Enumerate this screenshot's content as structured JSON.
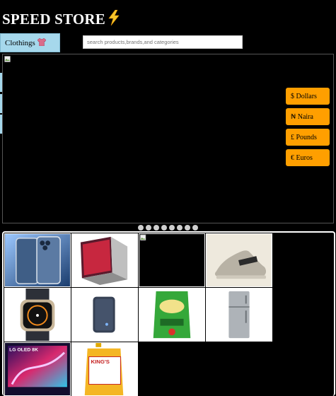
{
  "header": {
    "brand": "SPEED STORE",
    "brand_icon": "⚡"
  },
  "category_button": {
    "label": "Clothings",
    "icon": "👚"
  },
  "search": {
    "placeholder": "search products,brands,and categories"
  },
  "currency_buttons": [
    {
      "label": "$ Dollars"
    },
    {
      "label": "₦ Naira"
    },
    {
      "label": "£ Pounds"
    },
    {
      "label": "€ Euros"
    }
  ],
  "carousel": {
    "dots": 8
  },
  "products": [
    {
      "name": "iphone-product-image",
      "icon": "smartphone"
    },
    {
      "name": "laptop-product-image",
      "icon": "laptop"
    },
    {
      "name": "broken-product-image",
      "icon": "broken-image"
    },
    {
      "name": "sneaker-product-image",
      "icon": "sneaker"
    },
    {
      "name": "smartwatch-product-image",
      "icon": "smartwatch"
    },
    {
      "name": "powerbank-product-image",
      "icon": "power-bank"
    },
    {
      "name": "rice-bag-product-image",
      "icon": "rice-bag"
    },
    {
      "name": "refrigerator-product-image",
      "icon": "refrigerator"
    },
    {
      "name": "tv-product-image",
      "icon": "television"
    },
    {
      "name": "oil-jerrycan-product-image",
      "icon": "oil-jerrycan"
    }
  ],
  "product_images": {
    "tv_logo_text": "LG OLED 8K",
    "oil_label_text": "KING'S"
  }
}
